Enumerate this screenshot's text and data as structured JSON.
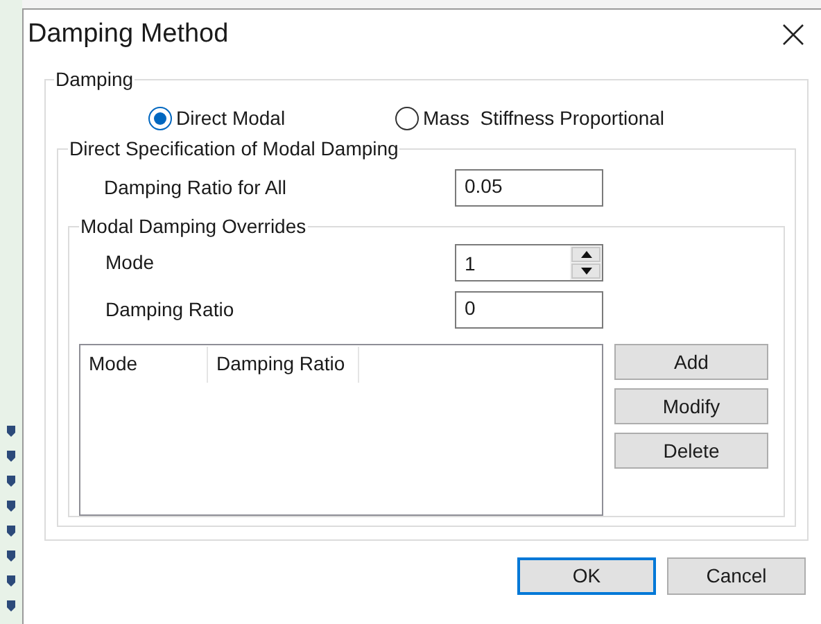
{
  "window": {
    "title": "Damping Method"
  },
  "damping": {
    "legend": "Damping",
    "options": [
      {
        "label": "Direct Modal",
        "selected": true
      },
      {
        "label": "Mass  Stiffness Proportional",
        "selected": false
      }
    ]
  },
  "direct_specification": {
    "legend": "Direct Specification of Modal Damping",
    "fields": [
      {
        "kind": "text",
        "label": "Damping Ratio for All",
        "value": "0.05"
      }
    ]
  },
  "overrides": {
    "legend": "Modal Damping Overrides",
    "fields": [
      {
        "kind": "spin",
        "label": "Mode",
        "value": "1"
      },
      {
        "kind": "text",
        "label": "Damping Ratio",
        "value": "0"
      }
    ],
    "list": {
      "columns": [
        "Mode",
        "Damping Ratio"
      ]
    },
    "buttons": [
      "Add",
      "Modify",
      "Delete"
    ]
  },
  "buttons": [
    {
      "label": "OK",
      "default": true
    },
    {
      "label": "Cancel",
      "default": false
    }
  ]
}
